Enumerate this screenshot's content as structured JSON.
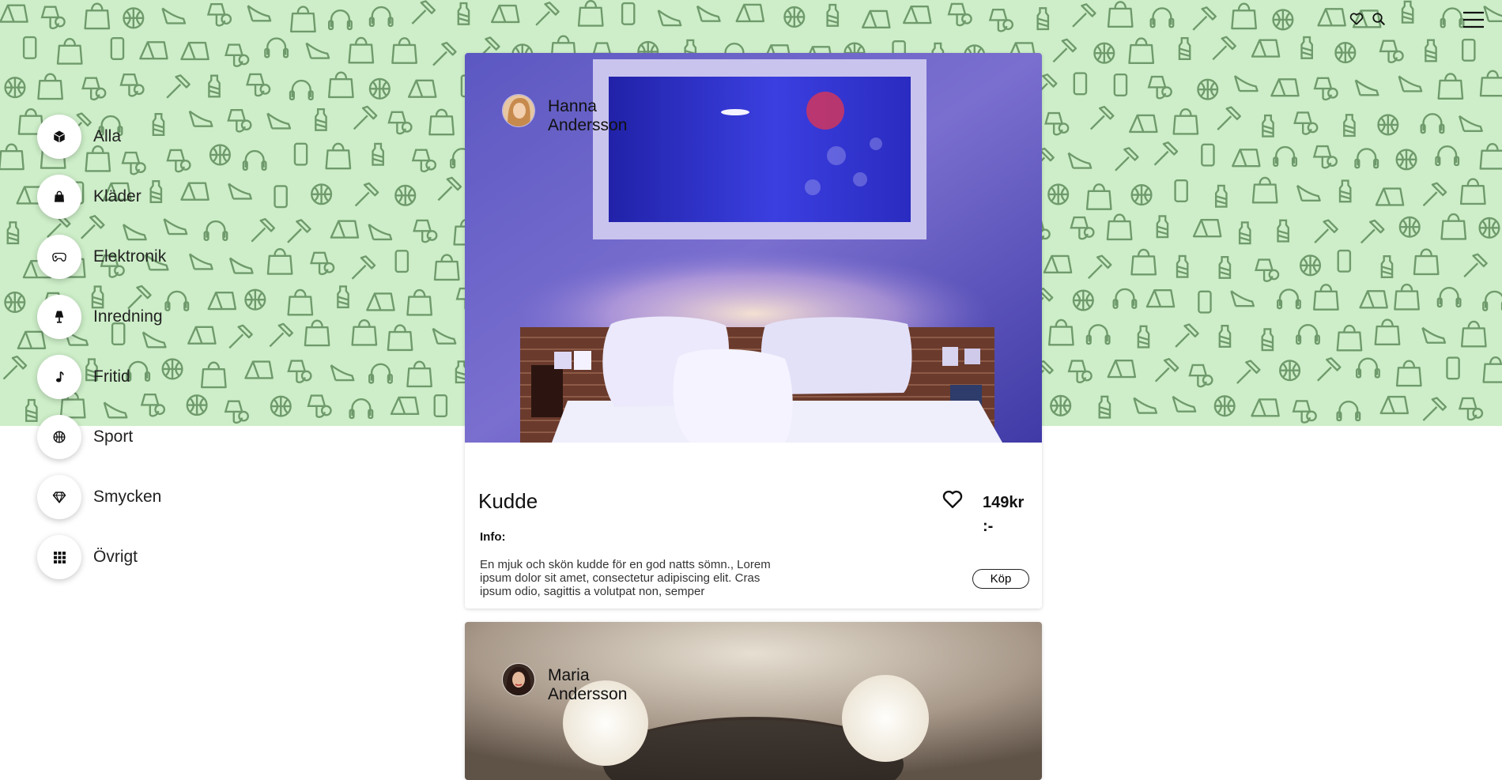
{
  "header": {
    "icons": [
      "heart-icon",
      "search-icon",
      "hamburger-menu-icon"
    ]
  },
  "categories": [
    {
      "label": "Alla",
      "icon": "box-icon"
    },
    {
      "label": "Kläder",
      "icon": "bag-icon"
    },
    {
      "label": "Elektronik",
      "icon": "gamepad-icon"
    },
    {
      "label": "Inredning",
      "icon": "lamp-icon"
    },
    {
      "label": "Fritid",
      "icon": "music-note-icon"
    },
    {
      "label": "Sport",
      "icon": "ball-icon"
    },
    {
      "label": "Smycken",
      "icon": "diamond-icon"
    },
    {
      "label": "Övrigt",
      "icon": "grid-icon"
    }
  ],
  "listings": [
    {
      "seller": "Hanna Andersson",
      "title": "Kudde",
      "price": "149kr :-",
      "info_label": "Info:",
      "description": "En mjuk och skön kudde för en god natts sömn., Lorem ipsum dolor sit amet, consectetur adipiscing elit. Cras ipsum odio, sagittis a volutpat non, semper",
      "buy_label": "Köp"
    },
    {
      "seller": "Maria Andersson"
    }
  ],
  "colors": {
    "banner": "#cdeec8",
    "pattern": "#6f9a6c"
  }
}
